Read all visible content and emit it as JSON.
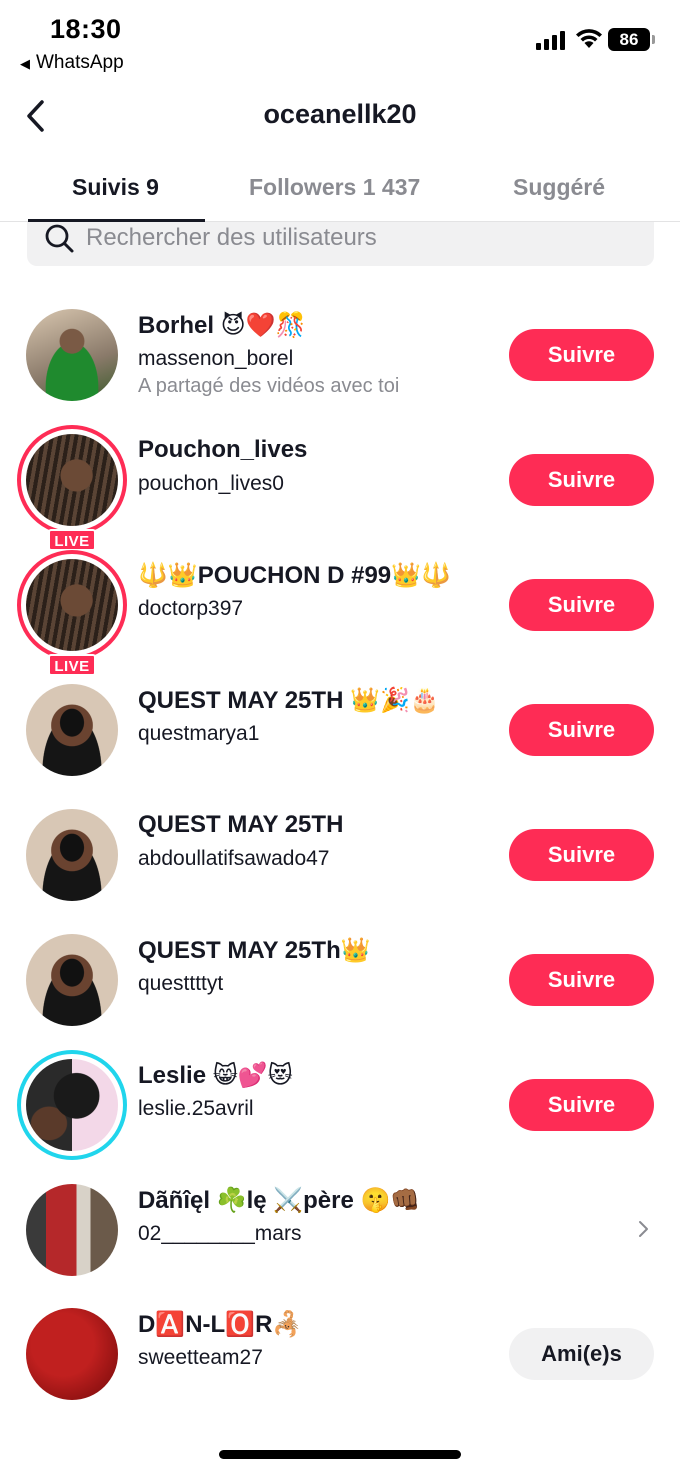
{
  "status": {
    "time": "18:30",
    "back_app": "WhatsApp",
    "battery": "86"
  },
  "header": {
    "title": "oceanellk20"
  },
  "tabs": [
    {
      "label": "Suivis 9"
    },
    {
      "label": "Followers 1 437"
    },
    {
      "label": "Suggéré"
    }
  ],
  "search": {
    "placeholder": "Rechercher des utilisateurs"
  },
  "users": [
    {
      "display_name": "Borhel 😈❤️🎊",
      "username": "massenon_borel",
      "subtitle": "A partagé des vidéos avec toi",
      "action": "Suivre",
      "live": false
    },
    {
      "display_name": "Pouchon_lives",
      "username": "pouchon_lives0",
      "action": "Suivre",
      "live": true,
      "live_label": "LIVE"
    },
    {
      "display_name": "🔱👑POUCHON D #99👑🔱",
      "username": "doctorp397",
      "action": "Suivre",
      "live": true,
      "live_label": "LIVE"
    },
    {
      "display_name": "QUEST MAY 25TH 👑🎉🎂",
      "username": "questmarya1",
      "action": "Suivre",
      "live": false
    },
    {
      "display_name": "QUEST MAY 25TH",
      "username": "abdoullatifsawado47",
      "action": "Suivre",
      "live": false
    },
    {
      "display_name": "QUEST MAY 25Th👑",
      "username": "questtttyt",
      "action": "Suivre",
      "live": false
    },
    {
      "display_name": "Leslie 😸💕😻",
      "username": "leslie.25avril",
      "action": "Suivre",
      "live": false,
      "story": true
    },
    {
      "display_name": "Dãñîęl ☘️lę ⚔️père 🤫👊🏾",
      "username": "02________mars",
      "action": "",
      "live": false
    },
    {
      "display_name": "D🅰️N-L🅾️R🦂",
      "username": "sweetteam27",
      "action": "Ami(e)s",
      "live": false
    }
  ],
  "colors": {
    "accent": "#fe2c55",
    "story_ring": "#20d5ec",
    "text": "#161823",
    "muted": "#8a8b91"
  }
}
